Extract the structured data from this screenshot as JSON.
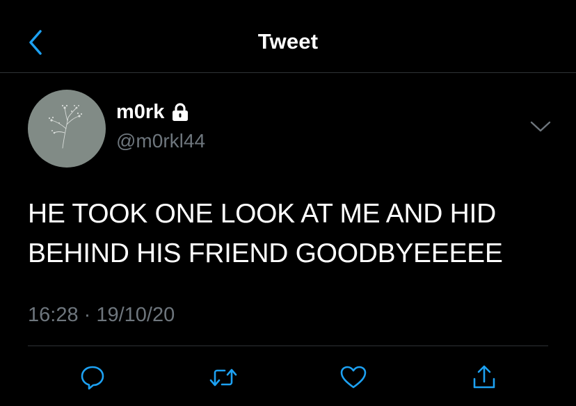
{
  "header": {
    "title": "Tweet"
  },
  "tweet": {
    "display_name": "m0rk",
    "handle": "@m0rkl44",
    "text_line1": "HE TOOK ONE LOOK AT ME AND HID",
    "text_line2": "BEHIND HIS FRIEND GOODBYEEEEE",
    "time": "16:28",
    "separator": " · ",
    "date": "19/10/20",
    "protected": true
  },
  "icons": {
    "back": "chevron-left-icon",
    "lock": "lock-icon",
    "menu": "chevron-down-icon",
    "reply": "reply-icon",
    "retweet": "retweet-icon",
    "like": "heart-icon",
    "share": "share-icon"
  },
  "colors": {
    "background": "#000000",
    "accent": "#1da1f2",
    "secondary_text": "#6e767d",
    "divider": "#2f3336",
    "avatar": "#818b86"
  }
}
